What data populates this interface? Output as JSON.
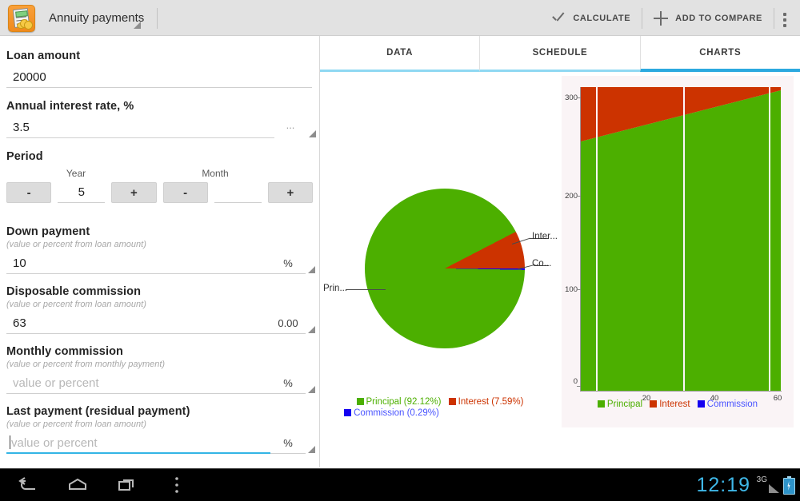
{
  "app": {
    "icon": "calculator-coins-icon",
    "title": "Annuity payments",
    "actions": [
      {
        "icon": "check-icon",
        "label": "CALCULATE"
      },
      {
        "icon": "plus-icon",
        "label": "ADD TO COMPARE"
      }
    ],
    "overflow_icon": "overflow-menu-icon"
  },
  "tabs": [
    {
      "label": "DATA",
      "active": false
    },
    {
      "label": "SCHEDULE",
      "active": false
    },
    {
      "label": "CHARTS",
      "active": true
    }
  ],
  "form": {
    "loan_amount": {
      "label": "Loan amount",
      "value": "20000"
    },
    "annual_rate": {
      "label": "Annual interest rate, %",
      "value": "3.5",
      "suffix": "...",
      "spinner": "dropdown-triangle-icon"
    },
    "period": {
      "label": "Period",
      "year_label": "Year",
      "month_label": "Month",
      "year_value": "5",
      "month_value": "",
      "minus": "-",
      "plus": "+"
    },
    "down_payment": {
      "label": "Down payment",
      "hint": "(value or percent from loan amount)",
      "value": "10",
      "unit": "%"
    },
    "disposable_commission": {
      "label": "Disposable commission",
      "hint": "(value or percent from loan amount)",
      "value": "63",
      "unit": "0.00"
    },
    "monthly_commission": {
      "label": "Monthly commission",
      "hint": "(value or percent from monthly payment)",
      "value": "",
      "placeholder": "value or percent",
      "unit": "%"
    },
    "last_payment": {
      "label": "Last payment (residual payment)",
      "hint": "(value or percent from loan amount)",
      "value": "",
      "placeholder": "value or percent",
      "unit": "%",
      "focused": true
    }
  },
  "colors": {
    "principal": "#4caf00",
    "interest": "#cc3300",
    "commission": "#1400f0",
    "accent": "#2ca9df"
  },
  "chart_data": [
    {
      "type": "pie",
      "title": "",
      "categories": [
        "Principal",
        "Interest",
        "Commission"
      ],
      "values": [
        92.12,
        7.59,
        0.29
      ],
      "colors": [
        "#4caf00",
        "#cc3300",
        "#1400f0"
      ],
      "callouts": [
        "Prin...",
        "Inter...",
        "Co..."
      ],
      "legend": [
        {
          "label": "Principal (92.12%)",
          "color": "#4caf00"
        },
        {
          "label": "Interest (7.59%)",
          "color": "#cc3300"
        },
        {
          "label": "Commission (0.29%)",
          "color": "#1400f0"
        }
      ],
      "legend_position": "bottom"
    },
    {
      "type": "area",
      "title": "",
      "xlabel": "",
      "ylabel": "",
      "x": [
        0,
        20,
        40,
        60
      ],
      "xticks": [
        "20",
        "40",
        "60"
      ],
      "yticks": [
        "0",
        "100",
        "200",
        "300"
      ],
      "xlim": [
        0,
        60
      ],
      "ylim": [
        0,
        330
      ],
      "grid": false,
      "stacked": true,
      "series": [
        {
          "name": "Principal",
          "color": "#4caf00",
          "values": [
            272,
            295,
            312,
            327
          ]
        },
        {
          "name": "Interest",
          "color": "#cc3300",
          "values": [
            55,
            32,
            15,
            1
          ]
        },
        {
          "name": "Commission",
          "color": "#1400f0",
          "values": [
            1,
            1,
            1,
            1
          ]
        }
      ],
      "legend": [
        {
          "label": "Principal",
          "color": "#4caf00"
        },
        {
          "label": "Interest",
          "color": "#cc3300"
        },
        {
          "label": "Commission",
          "color": "#1400f0"
        }
      ],
      "legend_position": "bottom"
    }
  ],
  "system": {
    "back_icon": "back-arrow-icon",
    "home_icon": "home-icon",
    "recents_icon": "recent-apps-icon",
    "menu_icon": "menu-dots-icon",
    "clock": "12:19",
    "network": "3G",
    "signal_icon": "signal-icon",
    "battery_icon": "battery-charging-icon"
  }
}
